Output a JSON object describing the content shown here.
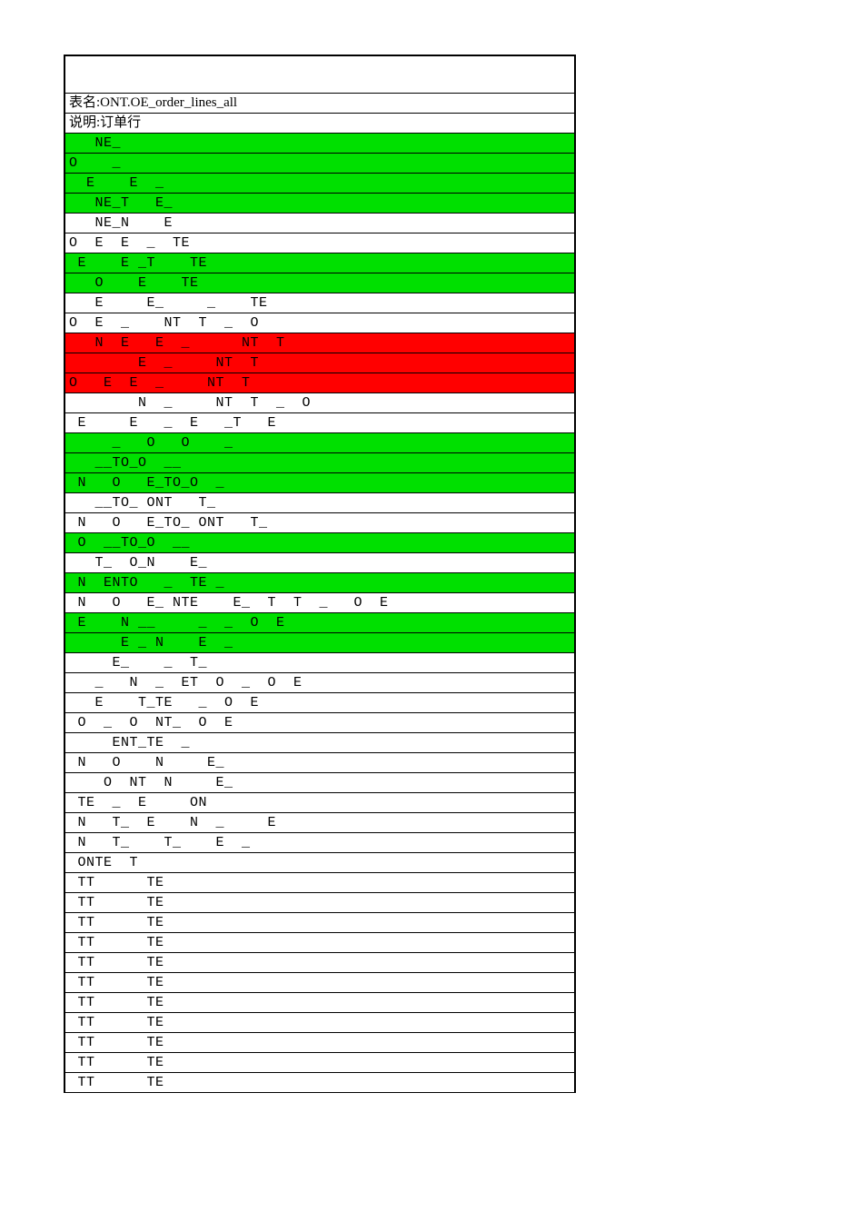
{
  "header": {
    "table_name_label": "表名:ONT.OE_order_lines_all",
    "desc_label": "说明:订单行"
  },
  "rows": [
    {
      "text": "   NE_",
      "bg": "green"
    },
    {
      "text": "O    _",
      "bg": "green"
    },
    {
      "text": "  E    E  _",
      "bg": "green"
    },
    {
      "text": "   NE_T   E_",
      "bg": "green"
    },
    {
      "text": "   NE_N    E",
      "bg": "white"
    },
    {
      "text": "O  E  E  _  TE",
      "bg": "white"
    },
    {
      "text": " E    E _T    TE",
      "bg": "green"
    },
    {
      "text": "   O    E    TE",
      "bg": "green"
    },
    {
      "text": "   E     E_     _    TE",
      "bg": "white"
    },
    {
      "text": "O  E  _    NT  T  _  O",
      "bg": "white"
    },
    {
      "text": "   N  E   E  _      NT  T",
      "bg": "red"
    },
    {
      "text": "        E  _     NT  T",
      "bg": "red"
    },
    {
      "text": "O   E  E  _     NT  T",
      "bg": "red"
    },
    {
      "text": "        N  _     NT  T  _  O",
      "bg": "white"
    },
    {
      "text": " E     E   _  E   _T   E",
      "bg": "white"
    },
    {
      "text": "     _   O   O    _",
      "bg": "green"
    },
    {
      "text": "   __TO_O  __",
      "bg": "green"
    },
    {
      "text": " N   O   E_TO_O  _",
      "bg": "green"
    },
    {
      "text": "   __TO_ ONT   T_",
      "bg": "white"
    },
    {
      "text": " N   O   E_TO_ ONT   T_",
      "bg": "white"
    },
    {
      "text": " O  __TO_O  __",
      "bg": "green"
    },
    {
      "text": "   T_  O_N    E_",
      "bg": "white"
    },
    {
      "text": " N  ENTO   _  TE _",
      "bg": "green"
    },
    {
      "text": " N   O   E_ NTE    E_  T  T  _   O  E",
      "bg": "white"
    },
    {
      "text": " E    N __     _  _  O  E",
      "bg": "green"
    },
    {
      "text": "      E _ N    E  _",
      "bg": "green"
    },
    {
      "text": "     E_    _  T_",
      "bg": "white"
    },
    {
      "text": "   _   N  _  ET  O  _  O  E",
      "bg": "white"
    },
    {
      "text": "   E    T_TE   _  O  E",
      "bg": "white"
    },
    {
      "text": " O  _  O  NT_  O  E",
      "bg": "white"
    },
    {
      "text": "     ENT_TE  _",
      "bg": "white"
    },
    {
      "text": " N   O    N     E_",
      "bg": "white"
    },
    {
      "text": "    O  NT  N     E_",
      "bg": "white"
    },
    {
      "text": " TE  _  E     ON",
      "bg": "white"
    },
    {
      "text": " N   T_  E    N  _     E",
      "bg": "white"
    },
    {
      "text": " N   T_    T_    E  _",
      "bg": "white"
    },
    {
      "text": " ONTE  T",
      "bg": "white"
    },
    {
      "text": " TT      TE",
      "bg": "white"
    },
    {
      "text": " TT      TE",
      "bg": "white"
    },
    {
      "text": " TT      TE",
      "bg": "white"
    },
    {
      "text": " TT      TE",
      "bg": "white"
    },
    {
      "text": " TT      TE",
      "bg": "white"
    },
    {
      "text": " TT      TE",
      "bg": "white"
    },
    {
      "text": " TT      TE",
      "bg": "white"
    },
    {
      "text": " TT      TE",
      "bg": "white"
    },
    {
      "text": " TT      TE",
      "bg": "white"
    },
    {
      "text": " TT      TE",
      "bg": "white"
    },
    {
      "text": " TT      TE",
      "bg": "white"
    }
  ]
}
